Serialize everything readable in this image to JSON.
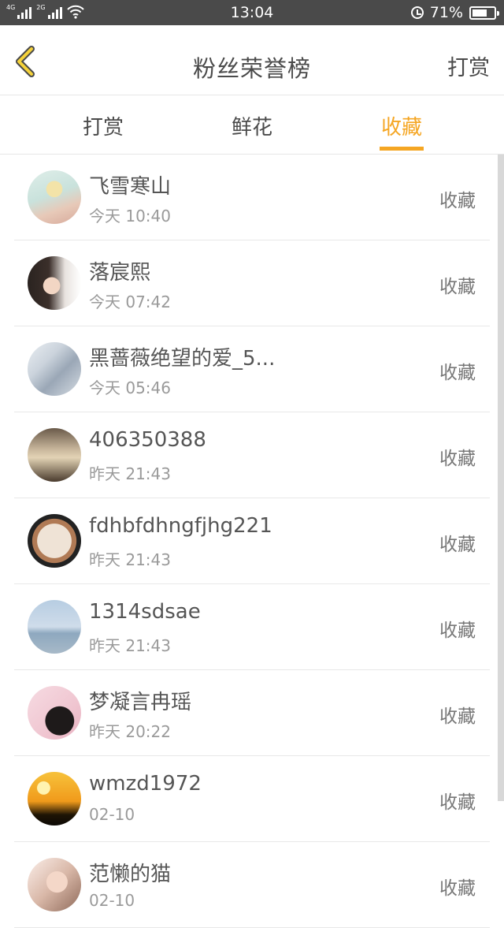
{
  "status_bar": {
    "network1": "4G",
    "network2": "2G",
    "time": "13:04",
    "battery": "71%",
    "battery_level": 0.71
  },
  "header": {
    "title": "粉丝荣誉榜",
    "right_action": "打赏"
  },
  "tabs": [
    {
      "label": "打赏",
      "active": false
    },
    {
      "label": "鲜花",
      "active": false
    },
    {
      "label": "收藏",
      "active": true
    }
  ],
  "fans": [
    {
      "name": "飞雪寒山",
      "time": "今天 10:40",
      "action": "收藏"
    },
    {
      "name": "落宸熙",
      "time": "今天 07:42",
      "action": "收藏"
    },
    {
      "name": "黑蔷薇绝望的爱_5...",
      "time": "今天 05:46",
      "action": "收藏"
    },
    {
      "name": "406350388",
      "time": "昨天 21:43",
      "action": "收藏"
    },
    {
      "name": "fdhbfdhngfjhg221",
      "time": "昨天 21:43",
      "action": "收藏"
    },
    {
      "name": "1314sdsae",
      "time": "昨天 21:43",
      "action": "收藏"
    },
    {
      "name": "梦凝言冉瑶",
      "time": "昨天 20:22",
      "action": "收藏"
    },
    {
      "name": "wmzd1972",
      "time": "02-10",
      "action": "收藏"
    },
    {
      "name": "范懒的猫",
      "time": "02-10",
      "action": "收藏"
    }
  ],
  "colors": {
    "accent": "#f5a623",
    "status_bar": "#4a4a4a"
  }
}
